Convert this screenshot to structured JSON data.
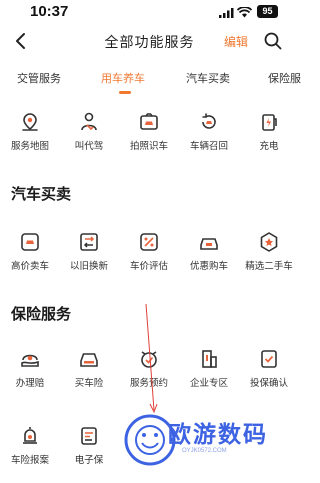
{
  "status_bar": {
    "time": "10:37",
    "battery": "95"
  },
  "header": {
    "title": "全部功能服务",
    "edit_label": "编辑"
  },
  "tabs": [
    {
      "label": "交管服务",
      "active": false
    },
    {
      "label": "用车养车",
      "active": true
    },
    {
      "label": "汽车买卖",
      "active": false
    },
    {
      "label": "保险服",
      "active": false
    }
  ],
  "rows": {
    "car_care": [
      {
        "label": "服务地图",
        "icon": "map-pin-icon"
      },
      {
        "label": "叫代驾",
        "icon": "driver-icon"
      },
      {
        "label": "拍照识车",
        "icon": "camera-car-icon"
      },
      {
        "label": "车辆召回",
        "icon": "recall-icon"
      },
      {
        "label": "充电",
        "icon": "charging-icon"
      }
    ],
    "car_trade": [
      {
        "label": "高价卖车",
        "icon": "sell-car-icon"
      },
      {
        "label": "以旧换新",
        "icon": "trade-in-icon"
      },
      {
        "label": "车价评估",
        "icon": "valuation-icon"
      },
      {
        "label": "优惠购车",
        "icon": "discount-car-icon"
      },
      {
        "label": "精选二手车",
        "icon": "used-car-icon"
      }
    ],
    "insurance_1": [
      {
        "label": "办理赔",
        "icon": "claim-icon"
      },
      {
        "label": "买车险",
        "icon": "buy-insurance-icon"
      },
      {
        "label": "服务预约",
        "icon": "appointment-icon"
      },
      {
        "label": "企业专区",
        "icon": "enterprise-icon"
      },
      {
        "label": "投保确认",
        "icon": "confirm-icon"
      }
    ],
    "insurance_2": [
      {
        "label": "车险报案",
        "icon": "report-icon"
      },
      {
        "label": "电子保",
        "icon": "e-policy-icon"
      }
    ]
  },
  "sections": {
    "car_trade_title": "汽车买卖",
    "insurance_title": "保险服务"
  },
  "watermark": {
    "text": "欧游数码",
    "sub": "OYJK0572.COM"
  },
  "colors": {
    "accent": "#f07830",
    "icon_stroke": "#333333",
    "icon_fill": "#e8643c",
    "watermark": "#3d63e3"
  }
}
